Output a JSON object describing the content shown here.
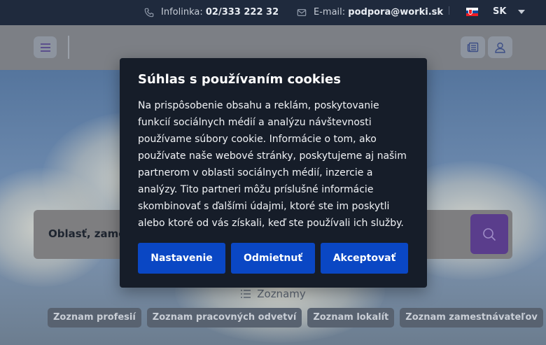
{
  "topbar": {
    "phone_label": "Infolinka:",
    "phone_value": "02/333 222 32",
    "email_label": "E-mail:",
    "email_value": "podpora@worki.sk",
    "language": "SK",
    "icons": [
      "phone-icon",
      "envelope-icon",
      "slovak-flag-icon",
      "caret-down-icon"
    ]
  },
  "header": {
    "icons": [
      "hamburger-menu-icon",
      "newspaper-icon",
      "user-icon"
    ]
  },
  "search": {
    "placeholder": "Oblasť, zames"
  },
  "lists": {
    "heading": "Zoznamy",
    "chips": [
      "Zoznam profesií",
      "Zoznam pracovných odvetví",
      "Zoznam lokalít",
      "Zoznam zamestnávateľov"
    ]
  },
  "cookie": {
    "title": "Súhlas s používaním cookies",
    "body": "Na prispôsobenie obsahu a reklám, poskytovanie funkcií sociálnych médií a analýzu návštevnosti používame súbory cookie. Informácie o tom, ako používate naše webové stránky, poskytujeme aj našim partnerom v oblasti sociálnych médií, inzercie a analýzy. Tito partneri môžu príslušné informácie skombinovať s ďalšími údajmi, ktoré ste im poskytli alebo ktoré od vás získali, keď ste používali ich služby.",
    "settings_label": "Nastavenie",
    "reject_label": "Odmietnuť",
    "accept_label": "Akceptovať"
  },
  "colors": {
    "topbar_bg": "#1f2a3d",
    "modal_bg": "#161d29",
    "button_blue": "#0a47c4",
    "search_button": "#5a3d8c"
  }
}
